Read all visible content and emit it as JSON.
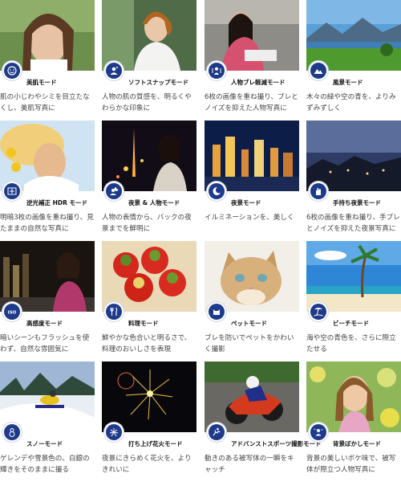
{
  "modes": [
    {
      "label": "美肌モード",
      "desc": "肌の小じわやシミを目立たなくし、美肌写真に",
      "icon": "face-smile-icon"
    },
    {
      "label": "ソフトスナップモード",
      "desc": "人物の肌の質感を、明るくやわらかな印象に",
      "icon": "person-snap-icon"
    },
    {
      "label": "人物ブレ軽減モード",
      "desc": "6枚の画像を重ね撮り、ブレとノイズを抑えた人物写真に",
      "icon": "person-steady-icon"
    },
    {
      "label": "風景モード",
      "desc": "木々の緑や空の青を、よりみずみずしく",
      "icon": "mountain-icon"
    },
    {
      "label": "逆光補正 HDR モード",
      "desc": "明暗3枚の画像を重ね撮り、見たままの自然な写真に",
      "icon": "hdr-backlight-icon"
    },
    {
      "label": "夜景 & 人物モード",
      "desc": "人物の表情から、バックの夜景までを鮮明に",
      "icon": "night-portrait-icon"
    },
    {
      "label": "夜景モード",
      "desc": "イルミネーションを、美しく",
      "icon": "moon-icon"
    },
    {
      "label": "手持ち夜景モード",
      "desc": "6枚の画像を重ね撮り、手ブレとノイズを抑えた夜景写真に",
      "icon": "hand-night-icon"
    },
    {
      "label": "高感度モード",
      "desc": "暗いシーンもフラッシュを使わず、自然な雰囲気に",
      "icon": "iso-icon"
    },
    {
      "label": "料理モード",
      "desc": "鮮やかな色合いと明るさで、料理のおいしさを表現",
      "icon": "fork-knife-icon"
    },
    {
      "label": "ペットモード",
      "desc": "ブレを防いでペットをかわいく撮影",
      "icon": "cat-icon"
    },
    {
      "label": "ビーチモード",
      "desc": "海や空の青色を、さらに際立たせる",
      "icon": "beach-icon"
    },
    {
      "label": "スノーモード",
      "desc": "ゲレンデや雪景色の、白銀の輝きをそのままに撮る",
      "icon": "snowman-icon"
    },
    {
      "label": "打ち上げ花火モード",
      "desc": "夜景にきらめく花火を、よりきれいに",
      "icon": "fireworks-icon"
    },
    {
      "label": "アドバンストスポーツ撮影モード",
      "desc": "動きのある被写体の一瞬をキャッチ",
      "icon": "sports-icon"
    },
    {
      "label": "背景ぼかしモード",
      "desc": "背景の美しいボケ味で、被写体が際立つ人物写真に",
      "icon": "background-blur-icon"
    }
  ]
}
